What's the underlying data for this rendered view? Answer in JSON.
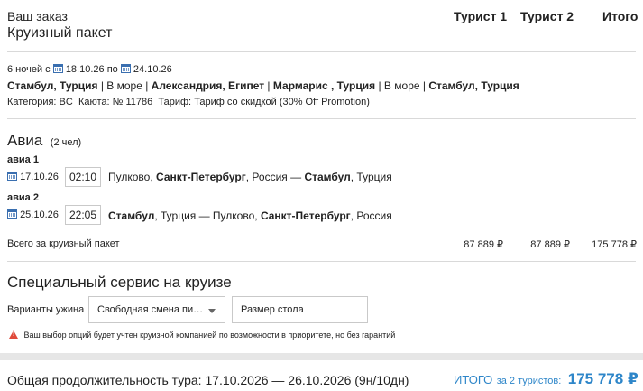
{
  "header": {
    "order_label": "Ваш заказ",
    "package_title": "Круизный пакет",
    "columns": [
      "Турист 1",
      "Турист 2",
      "Итого"
    ]
  },
  "cruise": {
    "nights_prefix": "6 ночей с",
    "date_from": "18.10.26",
    "by": "по",
    "date_to": "24.10.26",
    "route": [
      {
        "bold": "Стамбул, Турция"
      },
      {
        "plain": " | В море | "
      },
      {
        "bold": "Александрия, Египет"
      },
      {
        "plain": " | "
      },
      {
        "bold": "Мармарис , Турция"
      },
      {
        "plain": " | В море | "
      },
      {
        "bold": "Стамбул, Турция"
      }
    ],
    "category_label": "Категория:",
    "category_value": "BC",
    "cabin_label": "Каюта:",
    "cabin_value": "№ 11786",
    "tariff_label": "Тариф:",
    "tariff_value": "Тариф со скидкой (30% Off Promotion)"
  },
  "air": {
    "title": "Авиа",
    "pax": "(2 чел)",
    "flights": [
      {
        "label": "авиа 1",
        "date": "17.10.26",
        "time": "02:10",
        "from_airport": "Пулково, ",
        "from_city": "Санкт-Петербург",
        "from_country": ", Россия — ",
        "to_city": "Стамбул",
        "to_country": ", Турция"
      },
      {
        "label": "авиа 2",
        "date": "25.10.26",
        "time": "22:05",
        "from_airport": "",
        "from_city": "Стамбул",
        "from_country": ", Турция — Пулково, ",
        "to_city": "Санкт-Петербург",
        "to_country": ", Россия"
      }
    ]
  },
  "totals_row": {
    "label": "Всего за круизный пакет",
    "tourist1": "87 889 ₽",
    "tourist2": "87 889 ₽",
    "total": "175 778 ₽"
  },
  "special": {
    "title": "Специальный сервис на круизе",
    "dinner_label": "Варианты ужина",
    "dinner_value": "Свободная смена пит...",
    "table_value": "Размер стола",
    "warning": "Ваш выбор опций будет учтен круизной компанией по возможности в приоритете, но без гарантий"
  },
  "footer": {
    "duration": "Общая продолжительность тура: 17.10.2026 — 26.10.2026 (9н/10дн)",
    "total_label": "ИТОГО",
    "total_for": "за 2 туристов:",
    "total_value": "175 778 ₽"
  },
  "colors": {
    "accent": "#2e86c9",
    "calendar_icon": "#3a6fb0",
    "warning_icon": "#e04a3a"
  },
  "icons": [
    "calendar-icon",
    "chevron-down-icon",
    "warning-icon"
  ]
}
